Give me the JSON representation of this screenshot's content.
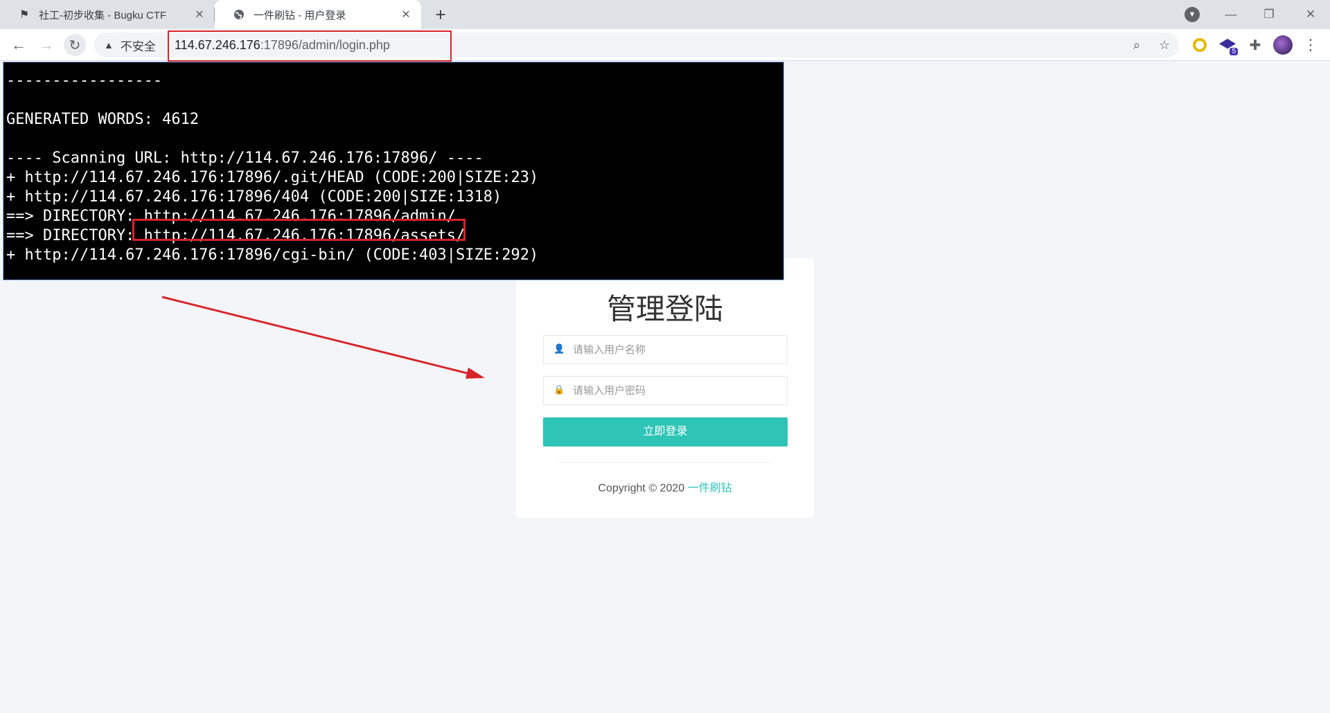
{
  "browser": {
    "tabs": [
      {
        "title": "社工-初步收集 - Bugku CTF",
        "close": "✕"
      },
      {
        "title": "一件刷钻 - 用户登录",
        "close": "✕"
      }
    ],
    "new_tab": "+",
    "window_controls": {
      "minimize": "—",
      "restore": "❐",
      "close": "✕"
    },
    "security_label": "不安全",
    "url_host": "114.67.246.176",
    "url_rest": ":17896/admin/login.php",
    "extension_badge": "5"
  },
  "terminal": {
    "lines": [
      "-----------------",
      "",
      "GENERATED WORDS: 4612",
      "",
      "---- Scanning URL: http://114.67.246.176:17896/ ----",
      "+ http://114.67.246.176:17896/.git/HEAD (CODE:200|SIZE:23)",
      "+ http://114.67.246.176:17896/404 (CODE:200|SIZE:1318)",
      "==> DIRECTORY: http://114.67.246.176:17896/admin/",
      "==> DIRECTORY: http://114.67.246.176:17896/assets/",
      "+ http://114.67.246.176:17896/cgi-bin/ (CODE:403|SIZE:292)"
    ]
  },
  "login": {
    "title": "管理登陆",
    "username_placeholder": "请输入用户名称",
    "password_placeholder": "请输入用户密码",
    "submit_label": "立即登录",
    "copyright_prefix": "Copyright © 2020",
    "site_name": "一件刷钻"
  },
  "colors": {
    "accent": "#2ec4b6",
    "highlight_red": "#d6242a",
    "page_bg": "#f4f5f9"
  }
}
